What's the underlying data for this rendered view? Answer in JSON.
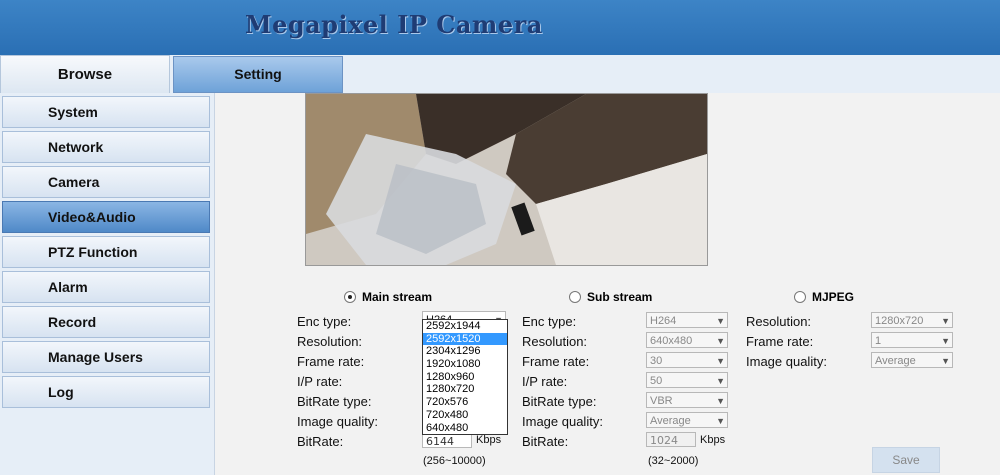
{
  "header": {
    "title": "Megapixel IP Camera"
  },
  "tabs": [
    {
      "label": "Browse"
    },
    {
      "label": "Setting"
    }
  ],
  "sidebar": {
    "items": [
      {
        "label": "System"
      },
      {
        "label": "Network"
      },
      {
        "label": "Camera"
      },
      {
        "label": "Video&Audio"
      },
      {
        "label": "PTZ Function"
      },
      {
        "label": "Alarm"
      },
      {
        "label": "Record"
      },
      {
        "label": "Manage Users"
      },
      {
        "label": "Log"
      }
    ],
    "active": "Video&Audio"
  },
  "main_stream": {
    "label": "Main stream",
    "selected": true,
    "fields": {
      "enc_type": {
        "label": "Enc type:",
        "value": "H264"
      },
      "resolution": {
        "label": "Resolution:"
      },
      "frame_rate": {
        "label": "Frame rate:"
      },
      "ip_rate": {
        "label": "I/P rate:"
      },
      "bitrate_type": {
        "label": "BitRate type:"
      },
      "image_quality": {
        "label": "Image quality:"
      },
      "bitrate": {
        "label": "BitRate:",
        "value": "6144",
        "unit": "Kbps",
        "range": "(256~10000)"
      }
    },
    "resolution_dropdown": {
      "options": [
        "2592x1944",
        "2592x1520",
        "2304x1296",
        "1920x1080",
        "1280x960",
        "1280x720",
        "720x576",
        "720x480",
        "640x480"
      ],
      "highlighted": "2592x1520"
    }
  },
  "sub_stream": {
    "label": "Sub stream",
    "selected": false,
    "fields": {
      "enc_type": {
        "label": "Enc type:",
        "value": "H264"
      },
      "resolution": {
        "label": "Resolution:",
        "value": "640x480"
      },
      "frame_rate": {
        "label": "Frame rate:",
        "value": "30"
      },
      "ip_rate": {
        "label": "I/P rate:",
        "value": "50"
      },
      "bitrate_type": {
        "label": "BitRate type:",
        "value": "VBR"
      },
      "image_quality": {
        "label": "Image quality:",
        "value": "Average"
      },
      "bitrate": {
        "label": "BitRate:",
        "value": "1024",
        "unit": "Kbps",
        "range": "(32~2000)"
      }
    }
  },
  "mjpeg": {
    "label": "MJPEG",
    "selected": false,
    "fields": {
      "resolution": {
        "label": "Resolution:",
        "value": "1280x720"
      },
      "frame_rate": {
        "label": "Frame rate:",
        "value": "1"
      },
      "image_quality": {
        "label": "Image quality:",
        "value": "Average"
      }
    }
  },
  "actions": {
    "save_label": "Save"
  }
}
